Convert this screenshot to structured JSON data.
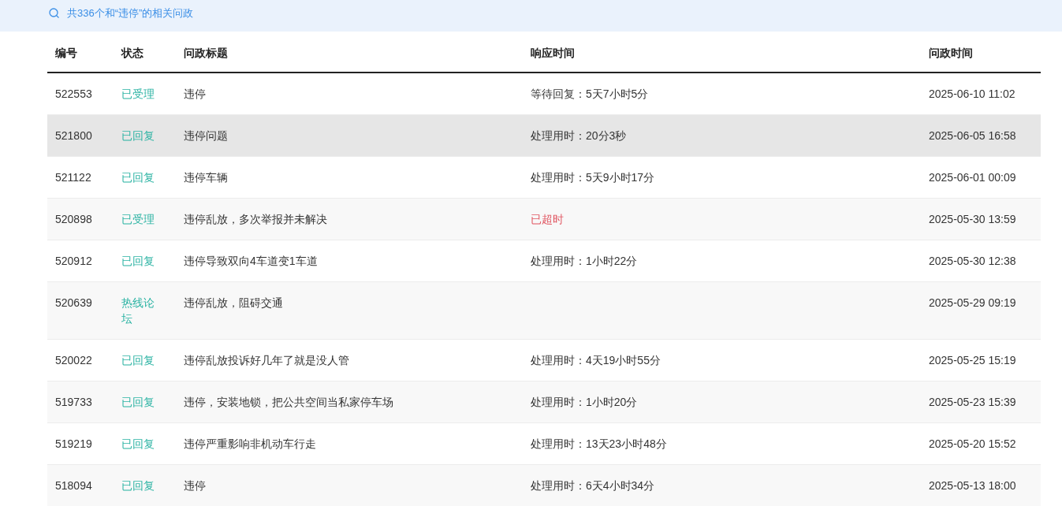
{
  "search_summary": {
    "text": "共336个和“违停”的相关问政"
  },
  "table": {
    "columns": [
      "编号",
      "状态",
      "问政标题",
      "响应时间",
      "问政时间"
    ],
    "rows": [
      {
        "id": "522553",
        "status": "已受理",
        "title": "违停",
        "response": {
          "text": "等待回复：5天7小时5分",
          "kind": "normal"
        },
        "time": "2025-06-10 11:02",
        "highlighted": false
      },
      {
        "id": "521800",
        "status": "已回复",
        "title": "违停问题",
        "response": {
          "text": "处理用时：20分3秒",
          "kind": "normal"
        },
        "time": "2025-06-05 16:58",
        "highlighted": true
      },
      {
        "id": "521122",
        "status": "已回复",
        "title": "违停车辆",
        "response": {
          "text": "处理用时：5天9小时17分",
          "kind": "normal"
        },
        "time": "2025-06-01 00:09",
        "highlighted": false
      },
      {
        "id": "520898",
        "status": "已受理",
        "title": "违停乱放，多次举报并未解决",
        "response": {
          "text": "已超时",
          "kind": "overdue"
        },
        "time": "2025-05-30 13:59",
        "highlighted": false
      },
      {
        "id": "520912",
        "status": "已回复",
        "title": "违停导致双向4车道变1车道",
        "response": {
          "text": "处理用时：1小时22分",
          "kind": "normal"
        },
        "time": "2025-05-30 12:38",
        "highlighted": false
      },
      {
        "id": "520639",
        "status": "热线论坛",
        "title": "违停乱放，阻碍交通",
        "time": "2025-05-29 09:19",
        "highlighted": false
      },
      {
        "id": "520022",
        "status": "已回复",
        "title": "违停乱放投诉好几年了就是没人管",
        "response": {
          "text": "处理用时：4天19小时55分",
          "kind": "normal"
        },
        "time": "2025-05-25 15:19",
        "highlighted": false
      },
      {
        "id": "519733",
        "status": "已回复",
        "title": "违停，安装地锁，把公共空间当私家停车场",
        "response": {
          "text": "处理用时：1小时20分",
          "kind": "normal"
        },
        "time": "2025-05-23 15:39",
        "highlighted": false
      },
      {
        "id": "519219",
        "status": "已回复",
        "title": "违停严重影响非机动车行走",
        "response": {
          "text": "处理用时：13天23小时48分",
          "kind": "normal"
        },
        "time": "2025-05-20 15:52",
        "highlighted": false
      },
      {
        "id": "518094",
        "status": "已回复",
        "title": "违停",
        "response": {
          "text": "处理用时：6天4小时34分",
          "kind": "normal"
        },
        "time": "2025-05-13 18:00",
        "highlighted": false
      }
    ]
  }
}
